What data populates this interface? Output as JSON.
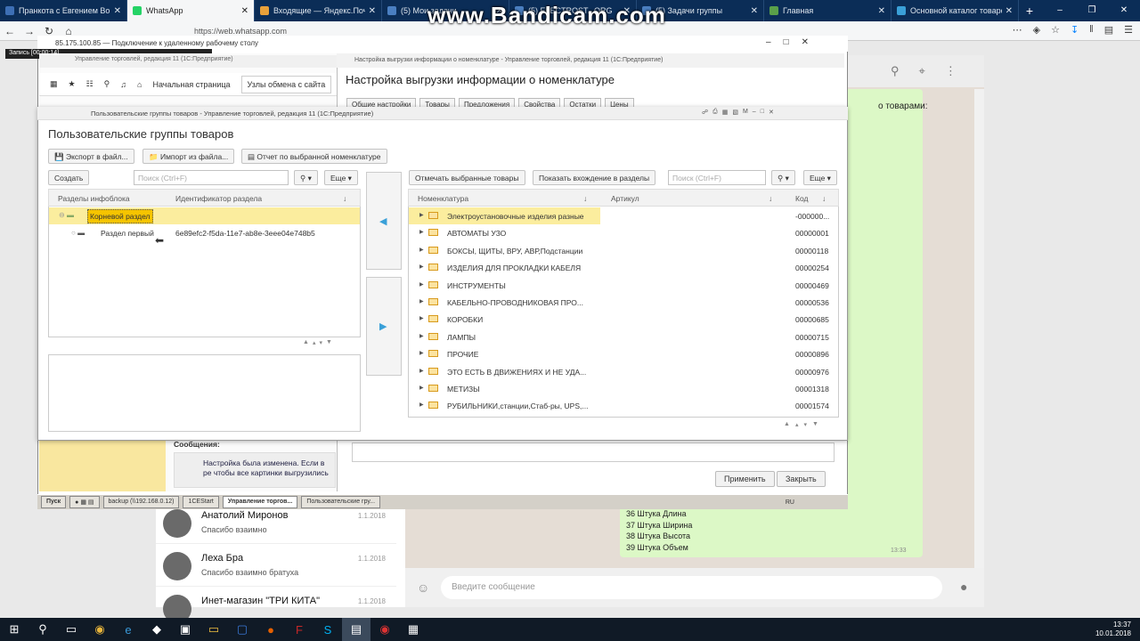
{
  "browser": {
    "tabs": [
      {
        "label": "Пранкота с Евгением Во",
        "color": "#3d6fb5"
      },
      {
        "label": "WhatsApp",
        "color": "#25d366"
      },
      {
        "label": "Входящие — Яндекс.Почта",
        "color": "#e8a13a"
      },
      {
        "label": "(5) Мои задачи",
        "color": "#4a7fc1"
      },
      {
        "label": "(5) ELECTROST...ORG",
        "color": "#4a7fc1"
      },
      {
        "label": "(5) Задачи группы",
        "color": "#4a7fc1"
      },
      {
        "label": "Главная",
        "color": "#5aa04a"
      },
      {
        "label": "Основной каталог товаров",
        "color": "#3aa0d8"
      }
    ],
    "url": "https://web.whatsapp.com"
  },
  "watermark": "www.Bandicam.com",
  "rdp": {
    "title": "85.175.100.85 — Подключение к удаленному рабочему столу",
    "recording": "Запись [00:00:14]"
  },
  "back_window": {
    "title": "Управление торговлей, редакция 11 (1С:Предприятие)",
    "home_tab": "Начальная страница",
    "exchange_tab": "Узлы обмена с сайта",
    "notice_heading": "Сообщения:",
    "notice_text": "Настройка была изменена. Если в ре чтобы все картинки выгрузились"
  },
  "settings_window": {
    "title": "Настройка выгрузки информации о номенклатуре - Управление торговлей, редакция 11 (1С:Предприятие)",
    "caption": "Настройка выгрузки информации о номенклатуре",
    "tabs": [
      "Общие настройки",
      "Товары",
      "Предложения",
      "Свойства",
      "Остатки",
      "Цены"
    ],
    "apply": "Применить",
    "close": "Закрыть"
  },
  "dialog": {
    "title": "Пользовательские группы товаров - Управление торговлей, редакция 11 (1С:Предприятие)",
    "caption": "Пользовательские группы товаров",
    "export_btn": "Экспорт в файл...",
    "import_btn": "Импорт из файла...",
    "report_btn": "Отчет по выбранной номенклатуре",
    "create_btn": "Создать",
    "search_placeholder": "Поиск (Ctrl+F)",
    "more_btn": "Еще",
    "mark_btn": "Отмечать выбранные товары",
    "show_btn": "Показать вхождение в разделы",
    "left_cols": [
      "Разделы инфоблока",
      "Идентификатор раздела"
    ],
    "sections": [
      {
        "name": "Корневой раздел",
        "id": ""
      },
      {
        "name": "Раздел первый",
        "id": "6e89efc2-f5da-11e7-ab8e-3eee04e748b5"
      }
    ],
    "right_cols": [
      "Номенклатура",
      "Артикул",
      "Код"
    ],
    "items": [
      {
        "name": "Электроустановочные изделия разные",
        "code": "-000000..."
      },
      {
        "name": "АВТОМАТЫ УЗО",
        "code": "00000001"
      },
      {
        "name": "БОКСЫ, ЩИТЫ, ВРУ, АВР,Подстанции",
        "code": "00000118"
      },
      {
        "name": "ИЗДЕЛИЯ ДЛЯ ПРОКЛАДКИ КАБЕЛЯ",
        "code": "00000254"
      },
      {
        "name": "ИНСТРУМЕНТЫ",
        "code": "00000469"
      },
      {
        "name": "КАБЕЛЬНО-ПРОВОДНИКОВАЯ ПРО...",
        "code": "00000536"
      },
      {
        "name": "КОРОБКИ",
        "code": "00000685"
      },
      {
        "name": "ЛАМПЫ",
        "code": "00000715"
      },
      {
        "name": "ПРОЧИЕ",
        "code": "00000896"
      },
      {
        "name": "ЭТО ЕСТЬ В ДВИЖЕНИЯХ И НЕ УДА...",
        "code": "00000976"
      },
      {
        "name": "МЕТИЗЫ",
        "code": "00001318"
      },
      {
        "name": "РУБИЛЬНИКИ,станции,Стаб-ры, UPS,...",
        "code": "00001574"
      }
    ]
  },
  "rdp_taskbar": {
    "start": "Пуск",
    "items": [
      "backup (\\\\192.168.0.12)",
      "1CEStart",
      "Управление торгов...",
      "Пользовательские гру..."
    ],
    "lang": "RU"
  },
  "whatsapp": {
    "contacts": [
      {
        "name": "Анатолий Миронов",
        "msg": "Спасибо взаимно",
        "date": "1.1.2018"
      },
      {
        "name": "Леха Бра",
        "msg": "Спасибо взаимно братуха",
        "date": "1.1.2018"
      },
      {
        "name": "Инет-магазин \"ТРИ КИТА\"",
        "msg": "",
        "date": "1.1.2018"
      }
    ],
    "bubble_top": "о товарами:",
    "bubble_lines": [
      "36 Штука Длина",
      "37 Штука Ширина",
      "38 Штука Высота",
      "39 Штука Объем"
    ],
    "bubble_time": "13:33",
    "input_placeholder": "Введите сообщение"
  },
  "clock": {
    "time": "13:37",
    "date": "10.01.2018"
  }
}
